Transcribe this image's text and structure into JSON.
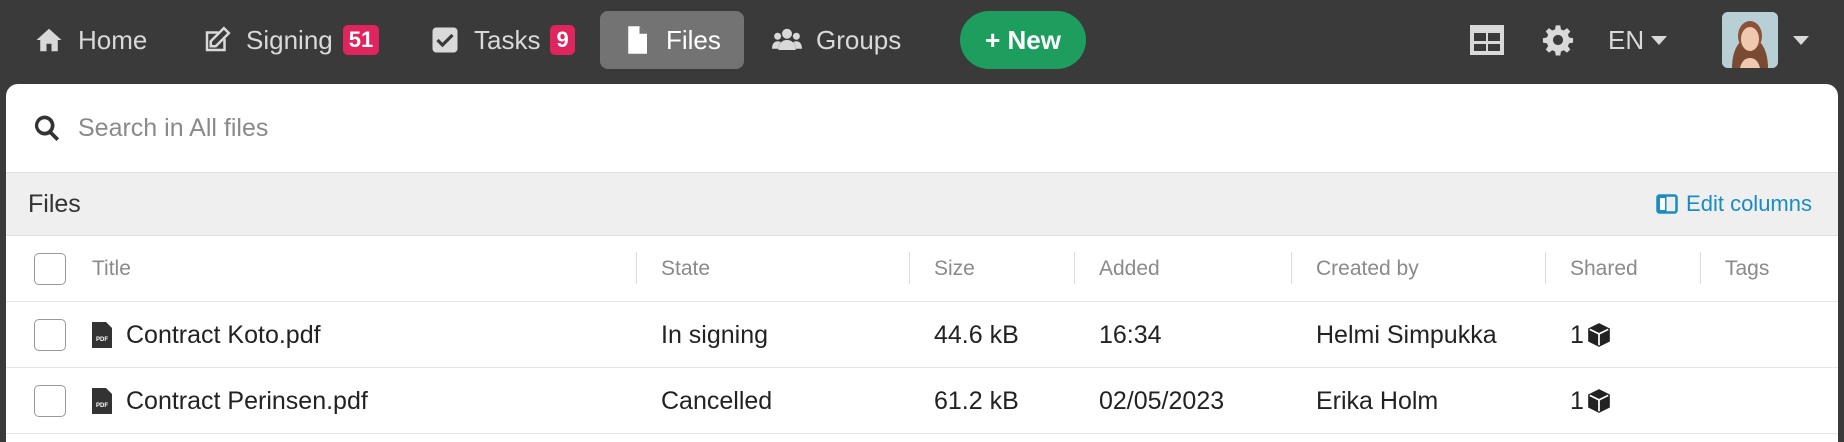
{
  "nav": {
    "home": "Home",
    "signing": "Signing",
    "signing_count": "51",
    "tasks": "Tasks",
    "tasks_count": "9",
    "files": "Files",
    "groups": "Groups",
    "new_button": "+ New",
    "language": "EN",
    "icons": [
      "home-icon",
      "edit-icon",
      "checkbox-icon",
      "file-icon",
      "users-icon",
      "grid-icon",
      "gear-icon",
      "chevron-down-icon"
    ]
  },
  "search": {
    "placeholder": "Search in All files"
  },
  "files_bar": {
    "title": "Files",
    "edit_columns": "Edit columns"
  },
  "table": {
    "columns": [
      "Title",
      "State",
      "Size",
      "Added",
      "Created by",
      "Shared",
      "Tags"
    ],
    "rows": [
      {
        "title": "Contract Koto.pdf",
        "state": "In signing",
        "size": "44.6 kB",
        "added": "16:34",
        "created_by": "Helmi Simpukka",
        "shared": "1",
        "tags": ""
      },
      {
        "title": "Contract Perinsen.pdf",
        "state": "Cancelled",
        "size": "61.2 kB",
        "added": "02/05/2023",
        "created_by": "Erika Holm",
        "shared": "1",
        "tags": ""
      }
    ]
  },
  "colors": {
    "topbar": "#3a3a3a",
    "new_button": "#1e9e5e",
    "badge": "#e0245e",
    "link": "#1a8cc0"
  }
}
